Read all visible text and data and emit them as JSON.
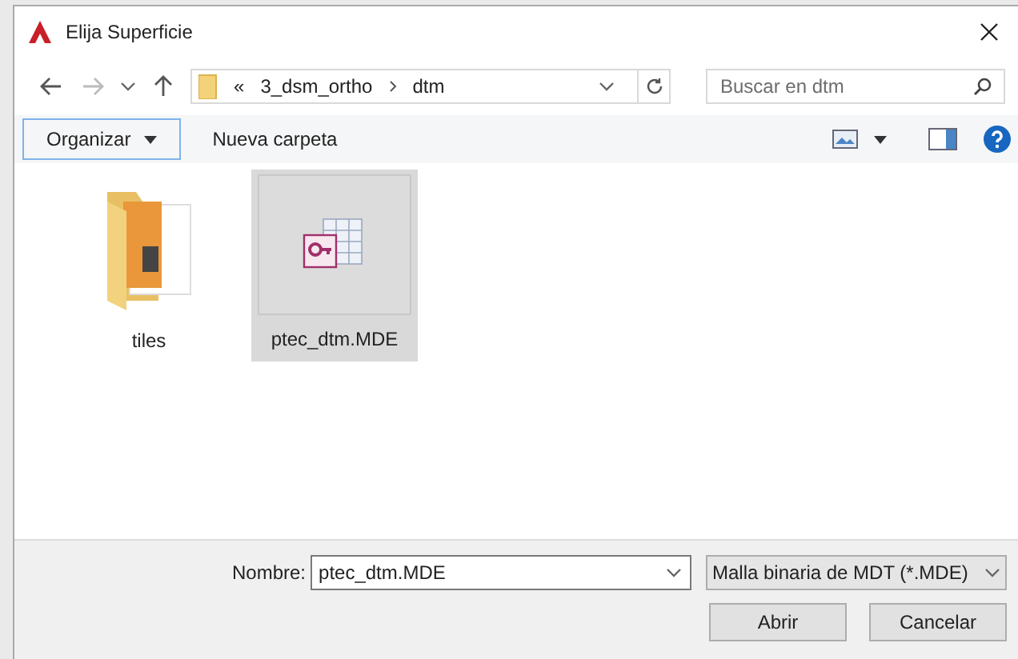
{
  "window": {
    "title": "Elija Superficie"
  },
  "address": {
    "parts": [
      "«",
      "3_dsm_ortho",
      "dtm"
    ]
  },
  "search": {
    "placeholder": "Buscar en dtm"
  },
  "toolbar": {
    "organize": "Organizar",
    "new_folder": "Nueva carpeta"
  },
  "items": [
    {
      "kind": "folder",
      "name": "tiles",
      "selected": false
    },
    {
      "kind": "database",
      "name": "ptec_dtm.MDE",
      "selected": true
    }
  ],
  "footer": {
    "name_label": "Nombre:",
    "name_value": "ptec_dtm.MDE",
    "filter": "Malla binaria de MDT (*.MDE)",
    "open": "Abrir",
    "cancel": "Cancelar"
  }
}
